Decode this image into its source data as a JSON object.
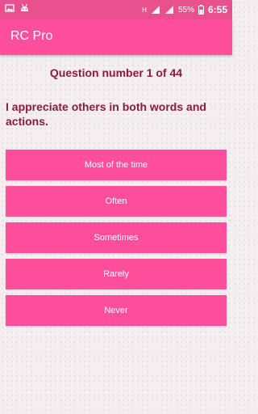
{
  "status_bar": {
    "network": "H",
    "battery": "55%",
    "time": "6:55"
  },
  "app_bar": {
    "title": "RC Pro"
  },
  "quiz": {
    "question_number": "Question number 1 of 44",
    "question_text": "I appreciate others in both words and actions.",
    "options": [
      {
        "label": "Most of the time"
      },
      {
        "label": "Often"
      },
      {
        "label": "Sometimes"
      },
      {
        "label": "Rarely"
      },
      {
        "label": "Never"
      }
    ]
  },
  "colors": {
    "accent": "#ff4e9b",
    "status_bar": "#e8508e",
    "question_text": "#8b1b3e"
  }
}
